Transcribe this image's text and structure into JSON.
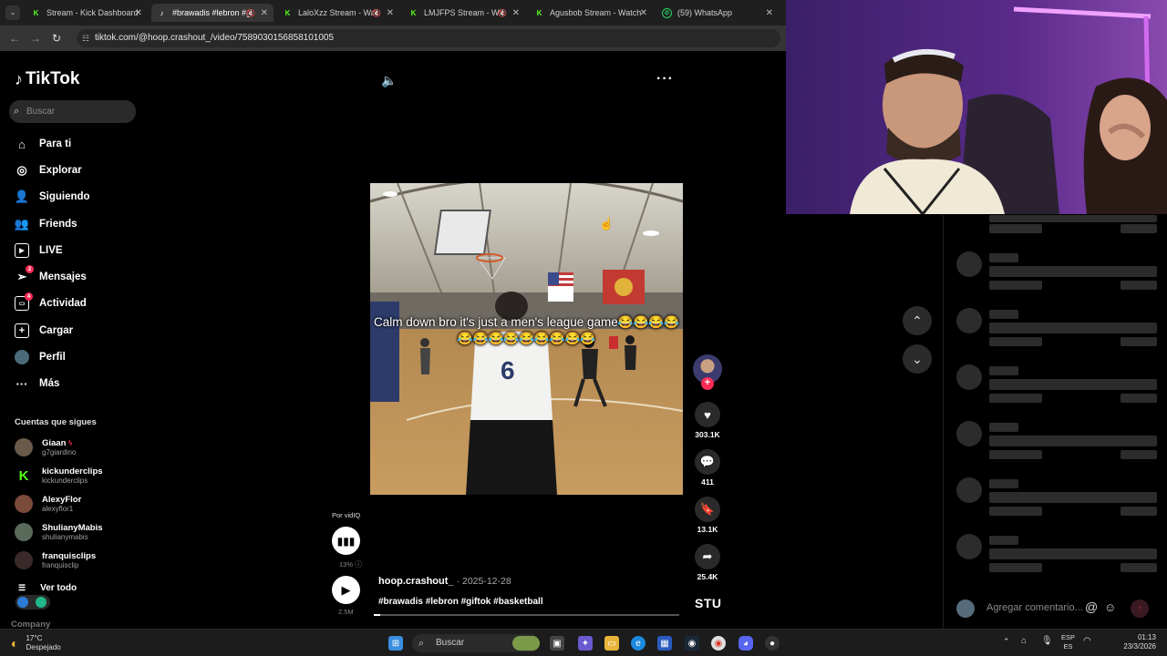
{
  "browser": {
    "tabs": [
      {
        "title": "Stream - Kick Dashboard",
        "favicon": "kick-icon",
        "color": "#53fc18"
      },
      {
        "title": "#brawadis #lebron #g",
        "favicon": "tiktok-icon",
        "color": "#ffffff",
        "active": true
      },
      {
        "title": "LaloXzz Stream - Wat",
        "favicon": "kick-icon",
        "color": "#53fc18"
      },
      {
        "title": "LMJFPS Stream - Wat",
        "favicon": "kick-icon",
        "color": "#53fc18"
      },
      {
        "title": "Agusbob Stream - Watch",
        "favicon": "kick-icon",
        "color": "#53fc18"
      },
      {
        "title": "(59) WhatsApp",
        "favicon": "whatsapp-icon",
        "color": "#25d366"
      }
    ],
    "url": "tiktok.com/@hoop.crashout_/video/7589030156858101005"
  },
  "tiktok": {
    "logo": "TikTok",
    "search_placeholder": "Buscar",
    "nav": [
      {
        "label": "Para ti",
        "icon": "home-icon"
      },
      {
        "label": "Explorar",
        "icon": "compass-icon"
      },
      {
        "label": "Siguiendo",
        "icon": "following-icon"
      },
      {
        "label": "Friends",
        "icon": "friends-icon"
      },
      {
        "label": "LIVE",
        "icon": "live-icon"
      },
      {
        "label": "Mensajes",
        "icon": "messages-icon",
        "badge": "2"
      },
      {
        "label": "Actividad",
        "icon": "activity-icon",
        "badge": "4"
      },
      {
        "label": "Cargar",
        "icon": "upload-icon"
      },
      {
        "label": "Perfil",
        "icon": "avatar-icon"
      },
      {
        "label": "Más",
        "icon": "more-icon"
      }
    ],
    "following_title": "Cuentas que sigues",
    "following": [
      {
        "name": "Giaan",
        "handle": "g7giardino"
      },
      {
        "name": "kickunderclips",
        "handle": "kickunderclips"
      },
      {
        "name": "AlexyFlor",
        "handle": "alexyflor1"
      },
      {
        "name": "ShulianyMabis",
        "handle": "shulianymabis"
      },
      {
        "name": "franquisclips",
        "handle": "franquisclip"
      }
    ],
    "see_all": "Ver todo",
    "company": "Company"
  },
  "video": {
    "caption": "Calm down bro it's just a men's league game😂😂😂😂😂😂😂😂😂😂😂😂😂",
    "by_label": "Por vidIQ",
    "percent": "13%",
    "plays": "2.5M",
    "author": "hoop.crashout_",
    "date": "· 2025-12-28",
    "hashtags": "#brawadis #lebron #giftok #basketball",
    "likes": "303.1K",
    "comments": "411",
    "saves": "13.1K",
    "shares": "25.4K",
    "watermark": "STU",
    "progress": 0.02
  },
  "comments_panel": {
    "placeholder": "Agregar comentario...",
    "at_symbol": "@"
  },
  "taskbar": {
    "temp": "17°C",
    "weather": "Despejado",
    "search": "Buscar",
    "lang1": "ESP",
    "lang2": "ES",
    "time": "01:13",
    "date": "23/3/2026"
  }
}
